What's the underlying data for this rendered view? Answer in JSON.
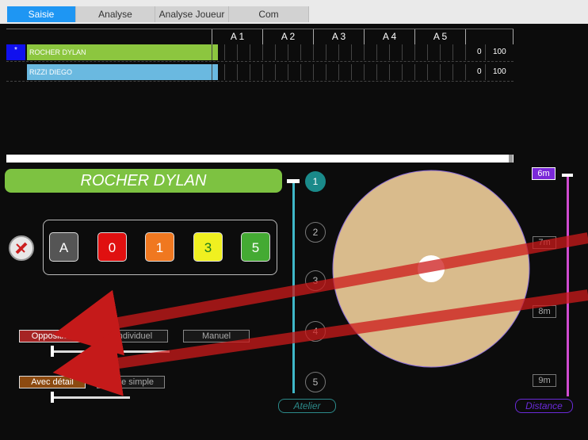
{
  "tabs": [
    {
      "label": "Saisie",
      "active": true
    },
    {
      "label": "Analyse",
      "active": false
    },
    {
      "label": "Analyse Joueur",
      "active": false
    },
    {
      "label": "Com",
      "active": false
    }
  ],
  "grid": {
    "headers": [
      "A 1",
      "A 2",
      "A 3",
      "A 4",
      "A 5"
    ],
    "rows": [
      {
        "marker": "*",
        "name": "ROCHER DYLAN",
        "score": "0",
        "total": "100",
        "color": "#8cc63f"
      },
      {
        "marker": "",
        "name": "RIZZI DIEGO",
        "score": "0",
        "total": "100",
        "color": "#6ab9e0"
      }
    ]
  },
  "player": {
    "name": "ROCHER  DYLAN"
  },
  "score_buttons": [
    {
      "label": "A",
      "bg": "#555555",
      "fg": "#ffffff"
    },
    {
      "label": "0",
      "bg": "#e01010",
      "fg": "#ffffff"
    },
    {
      "label": "1",
      "bg": "#f07820",
      "fg": "#ffffff"
    },
    {
      "label": "3",
      "bg": "#f0f020",
      "fg": "#1a7a1a"
    },
    {
      "label": "5",
      "bg": "#44aa33",
      "fg": "#ffffff"
    }
  ],
  "mode_buttons": {
    "opposition": "Opposition",
    "individuel": "Individuel",
    "manuel": "Manuel"
  },
  "detail_buttons": {
    "avec_detail": "Avec détail",
    "note_simple": "Note simple"
  },
  "atelier": {
    "items": [
      "1",
      "2",
      "3",
      "4",
      "5"
    ],
    "selected": "1",
    "label": "Atelier"
  },
  "distance": {
    "items": [
      "6m",
      "7m",
      "8m",
      "9m"
    ],
    "selected": "6m",
    "label": "Distance"
  },
  "colors": {
    "target_fill": "#d9bb8c",
    "atelier_accent": "#3fb8c8",
    "distance_accent": "#8a2be2",
    "arrow": "#cc1a1a"
  }
}
